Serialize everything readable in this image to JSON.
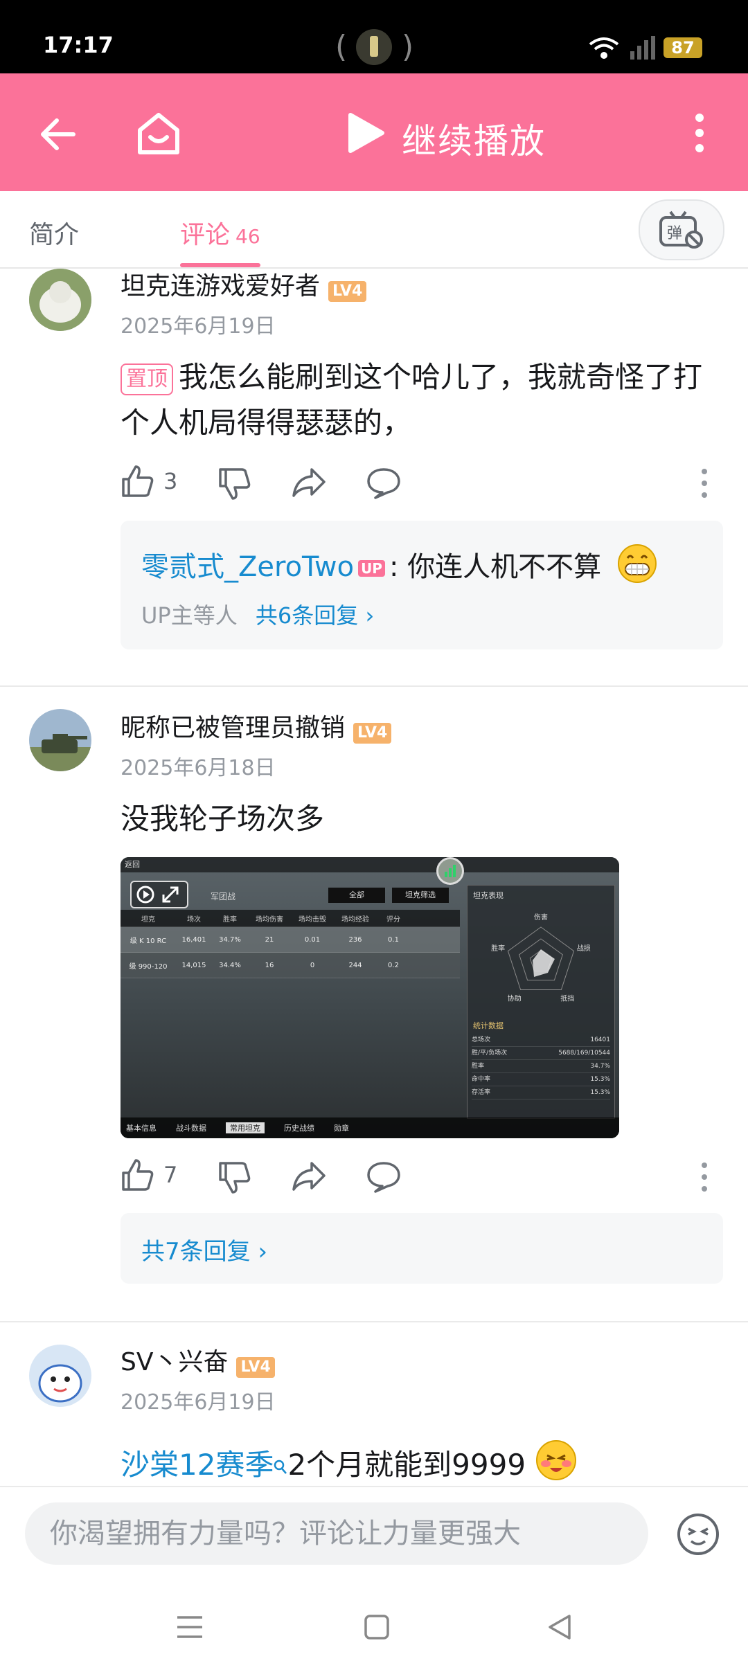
{
  "status_bar": {
    "time": "17:17",
    "battery": "87"
  },
  "header": {
    "title": "继续播放"
  },
  "tabs": [
    {
      "label": "简介"
    },
    {
      "label": "评论",
      "count": "46"
    }
  ],
  "comments": [
    {
      "username": "坦克连游戏爱好者",
      "level": "LV4",
      "date": "2025年6月19日",
      "pin_tag": "置顶",
      "text": "我怎么能刷到这个哈儿了，我就奇怪了打个人机局得得瑟瑟的，",
      "likes": "3",
      "reply": {
        "author": "零贰式_ZeroTwo",
        "author_badge": "UP",
        "text": ": 你连人机不不算",
        "meta": "UP主等人",
        "more": "共6条回复 ›"
      }
    },
    {
      "username": "昵称已被管理员撤销",
      "level": "LV4",
      "date": "2025年6月18日",
      "text": "没我轮子场次多",
      "likes": "7",
      "more": "共7条回复 ›",
      "screenshot": {
        "back": "返回",
        "top_tab": "军团战",
        "filter_all": "全部",
        "filter_tank": "坦克筛选",
        "columns": [
          "坦克",
          "场次",
          "胜率",
          "场均伤害",
          "场均击毁",
          "场均经验",
          "评分"
        ],
        "rows": [
          {
            "tank": "级 K 10 RC",
            "values": [
              "16,401",
              "34.7%",
              "21",
              "0.01",
              "236",
              "0.1"
            ]
          },
          {
            "tank": "级 990-120",
            "values": [
              "14,015",
              "34.4%",
              "16",
              "0",
              "244",
              "0.2"
            ]
          }
        ],
        "panel_title": "坦克表现",
        "radar_labels": [
          "伤害",
          "战损",
          "抵挡",
          "协助",
          "胜率"
        ],
        "stats_title": "统计数据",
        "stats": [
          {
            "k": "总场次",
            "v": "16401"
          },
          {
            "k": "胜/平/负场次",
            "v": "5688/169/10544"
          },
          {
            "k": "胜率",
            "v": "34.7%"
          },
          {
            "k": "命中率",
            "v": "15.3%"
          },
          {
            "k": "存活率",
            "v": "15.3%"
          }
        ],
        "bottom_tabs": [
          "基本信息",
          "战斗数据",
          "常用坦克",
          "历史战绩",
          "勋章"
        ]
      }
    },
    {
      "username": "SV丶兴奋",
      "level": "LV4",
      "date": "2025年6月19日",
      "link_text": "沙棠12赛季",
      "text": "2个月就能到9999"
    }
  ],
  "composer": {
    "placeholder": "你渴望拥有力量吗？评论让力量更强大"
  },
  "colors": {
    "accent": "#fb7299",
    "link": "#178bcf",
    "level": "#f6b26b"
  }
}
